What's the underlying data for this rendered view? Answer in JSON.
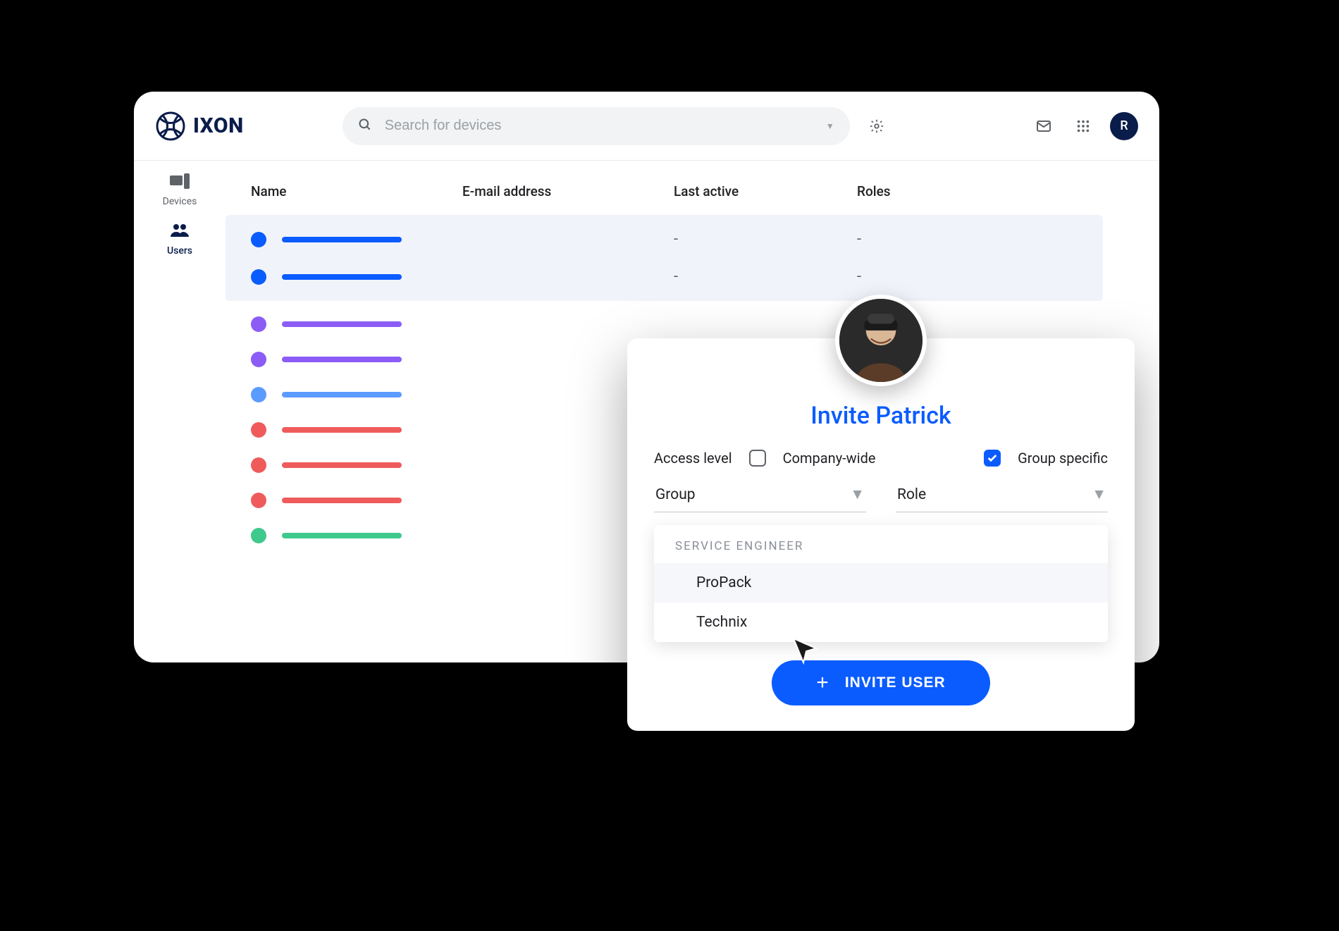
{
  "brand": {
    "name": "IXON"
  },
  "search": {
    "placeholder": "Search for devices"
  },
  "avatar_initial": "R",
  "sidebar": {
    "items": [
      {
        "id": "devices",
        "label": "Devices"
      },
      {
        "id": "users",
        "label": "Users"
      }
    ],
    "active": "users"
  },
  "table": {
    "columns": [
      "Name",
      "E-mail address",
      "Last active",
      "Roles"
    ],
    "rows": [
      {
        "color": "#0b5cff",
        "name_w": 170,
        "email_color": "#0b5cff",
        "email_w": 210,
        "last_active": "-",
        "roles": "-",
        "selected": true
      },
      {
        "color": "#0b5cff",
        "name_w": 170,
        "email_color": "#0b5cff",
        "email_w": 210,
        "last_active": "-",
        "roles": "-",
        "selected": true
      },
      {
        "color": "#8b5cf6",
        "name_w": 170,
        "email_color": "#cfd2d7",
        "email_w": 210,
        "last_active": "",
        "roles": "",
        "selected": false
      },
      {
        "color": "#8b5cf6",
        "name_w": 170,
        "email_color": "#cfd2d7",
        "email_w": 210,
        "last_active": "",
        "roles": "",
        "selected": false
      },
      {
        "color": "#5b9bff",
        "name_w": 170,
        "email_color": "#cfd2d7",
        "email_w": 210,
        "last_active": "",
        "roles": "",
        "selected": false
      },
      {
        "color": "#ef5b5b",
        "name_w": 170,
        "email_color": "#cfd2d7",
        "email_w": 210,
        "last_active": "",
        "roles": "",
        "selected": false
      },
      {
        "color": "#ef5b5b",
        "name_w": 170,
        "email_color": "#cfd2d7",
        "email_w": 210,
        "last_active": "",
        "roles": "",
        "selected": false
      },
      {
        "color": "#ef5b5b",
        "name_w": 170,
        "email_color": "#cfd2d7",
        "email_w": 210,
        "last_active": "",
        "roles": "",
        "selected": false
      },
      {
        "color": "#3fc98d",
        "name_w": 170,
        "email_color": "#cfd2d7",
        "email_w": 210,
        "last_active": "",
        "roles": "",
        "selected": false
      }
    ]
  },
  "invite": {
    "title": "Invite Patrick",
    "access_label": "Access level",
    "company_wide_label": "Company-wide",
    "company_wide_checked": false,
    "group_specific_label": "Group specific",
    "group_specific_checked": true,
    "group_label": "Group",
    "role_label": "Role",
    "dropdown": {
      "header": "SERVICE ENGINEER",
      "items": [
        "ProPack",
        "Technix"
      ],
      "hover_index": 0
    },
    "button_label": "INVITE USER"
  }
}
